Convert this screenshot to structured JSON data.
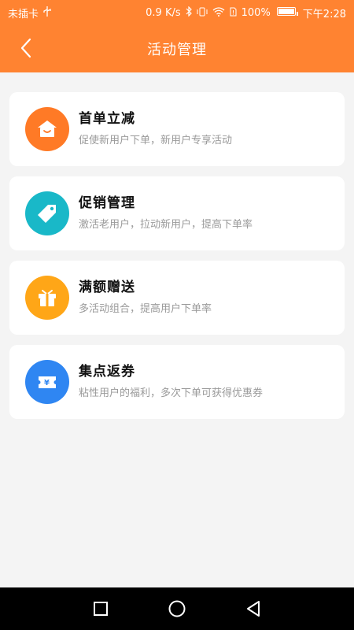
{
  "status_bar": {
    "carrier": "未插卡",
    "usb_icon": "usb-icon",
    "speed": "0.9 K/s",
    "battery_percent": "100%",
    "time": "下午2:28"
  },
  "header": {
    "title": "活动管理",
    "background_color": "#ff8331"
  },
  "cards": [
    {
      "title": "首单立减",
      "desc": "促使新用户下单，新用户专享活动",
      "icon": "house-gift-icon",
      "icon_color": "#ff7a26"
    },
    {
      "title": "促销管理",
      "desc": "激活老用户，拉动新用户，提高下单率",
      "icon": "price-tag-icon",
      "icon_color": "#19b8c8"
    },
    {
      "title": "满额赠送",
      "desc": "多活动组合，提高用户下单率",
      "icon": "gift-box-icon",
      "icon_color": "#ffa617"
    },
    {
      "title": "集点返券",
      "desc": "粘性用户的福利，多次下单可获得优惠券",
      "icon": "coupon-icon",
      "icon_color": "#2f86f2"
    }
  ],
  "bottom_nav": {
    "items": [
      "recent-apps-icon",
      "home-icon",
      "back-icon"
    ]
  }
}
